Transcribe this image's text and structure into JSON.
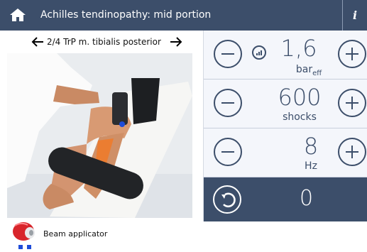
{
  "header": {
    "title": "Achilles tendinopathy: mid portion",
    "info_label": "i",
    "home_icon": "home-icon"
  },
  "treatment_nav": {
    "label": "2/4 TrP m. tibialis posterior",
    "prev_icon": "arrow-left-icon",
    "next_icon": "arrow-right-icon"
  },
  "applicator": {
    "label": "Beam applicator",
    "dots_count": 2
  },
  "settings": {
    "pressure": {
      "value": "1,6",
      "unit": "bar",
      "unit_sub": "eff"
    },
    "shocks": {
      "value": "600",
      "unit": "shocks"
    },
    "frequency": {
      "value": "8",
      "unit": "Hz"
    }
  },
  "counter": {
    "value": "0"
  },
  "colors": {
    "header": "#3c4e6a",
    "panel": "#f4f6fb",
    "accent": "#1e4bd8",
    "orange_highlight": "#f07a28"
  }
}
